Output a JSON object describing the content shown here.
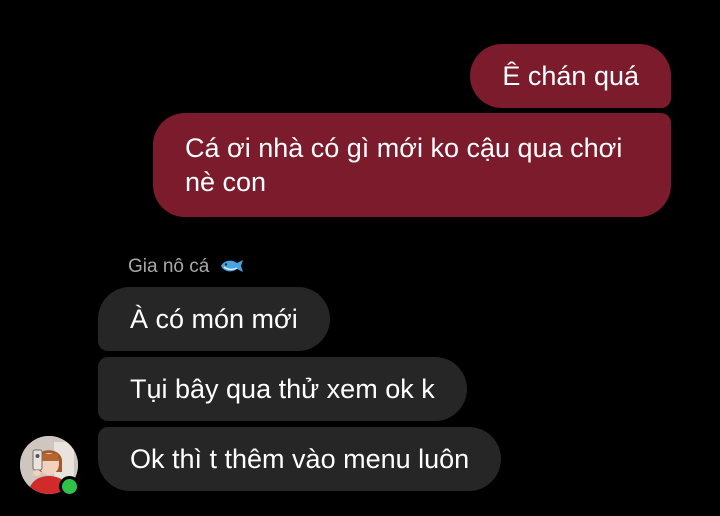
{
  "colors": {
    "background": "#000000",
    "outgoing_bubble": "#7c1b2c",
    "incoming_bubble": "#262626",
    "sender_name": "#a8a8a8",
    "online_indicator": "#2fc34a"
  },
  "chat": {
    "outgoing": [
      {
        "text": "Ê chán quá"
      },
      {
        "text": "Cá ơi nhà có gì mới ko cậu qua chơi nè con"
      }
    ],
    "sender_name": "Gia nô cá",
    "sender_emoji_icon": "fish-icon",
    "incoming": [
      {
        "text": "À có món mới"
      },
      {
        "text": "Tụi bây qua thử xem ok k"
      },
      {
        "text": "Ok thì t thêm vào menu luôn"
      }
    ],
    "avatar_icon": "avatar-photo",
    "online_status_icon": "online-dot-icon"
  }
}
